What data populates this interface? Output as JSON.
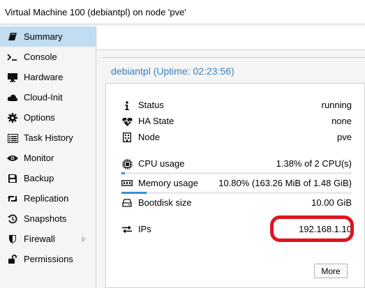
{
  "window": {
    "title": "Virtual Machine 100 (debiantpl) on node 'pve'"
  },
  "sidebar": {
    "items": [
      {
        "label": "Summary",
        "icon": "book-icon",
        "active": true
      },
      {
        "label": "Console",
        "icon": "terminal-icon"
      },
      {
        "label": "Hardware",
        "icon": "monitor-icon"
      },
      {
        "label": "Cloud-Init",
        "icon": "cloud-icon"
      },
      {
        "label": "Options",
        "icon": "gear-icon"
      },
      {
        "label": "Task History",
        "icon": "list-icon"
      },
      {
        "label": "Monitor",
        "icon": "eye-icon"
      },
      {
        "label": "Backup",
        "icon": "floppy-icon"
      },
      {
        "label": "Replication",
        "icon": "retweet-icon"
      },
      {
        "label": "Snapshots",
        "icon": "history-icon"
      },
      {
        "label": "Firewall",
        "icon": "shield-icon",
        "has_submenu": true
      },
      {
        "label": "Permissions",
        "icon": "unlock-icon"
      }
    ]
  },
  "summary": {
    "header": "debiantpl (Uptime: 02:23:56)",
    "status": {
      "label": "Status",
      "value": "running"
    },
    "ha_state": {
      "label": "HA State",
      "value": "none"
    },
    "node": {
      "label": "Node",
      "value": "pve"
    },
    "cpu": {
      "label": "CPU usage",
      "value": "1.38% of 2 CPU(s)",
      "fraction": 0.0138
    },
    "memory": {
      "label": "Memory usage",
      "value": "10.80% (163.26 MiB of 1.48 GiB)",
      "fraction": 0.108
    },
    "bootdisk": {
      "label": "Bootdisk size",
      "value": "10.00 GiB"
    },
    "ips": {
      "label": "IPs",
      "value": "192.168.1.10"
    },
    "more_label": "More"
  },
  "colors": {
    "accent": "#3c7fb8",
    "selected": "#c2ddf2",
    "highlight_ring": "#e0141e",
    "bar_fill": "#3892d4"
  }
}
